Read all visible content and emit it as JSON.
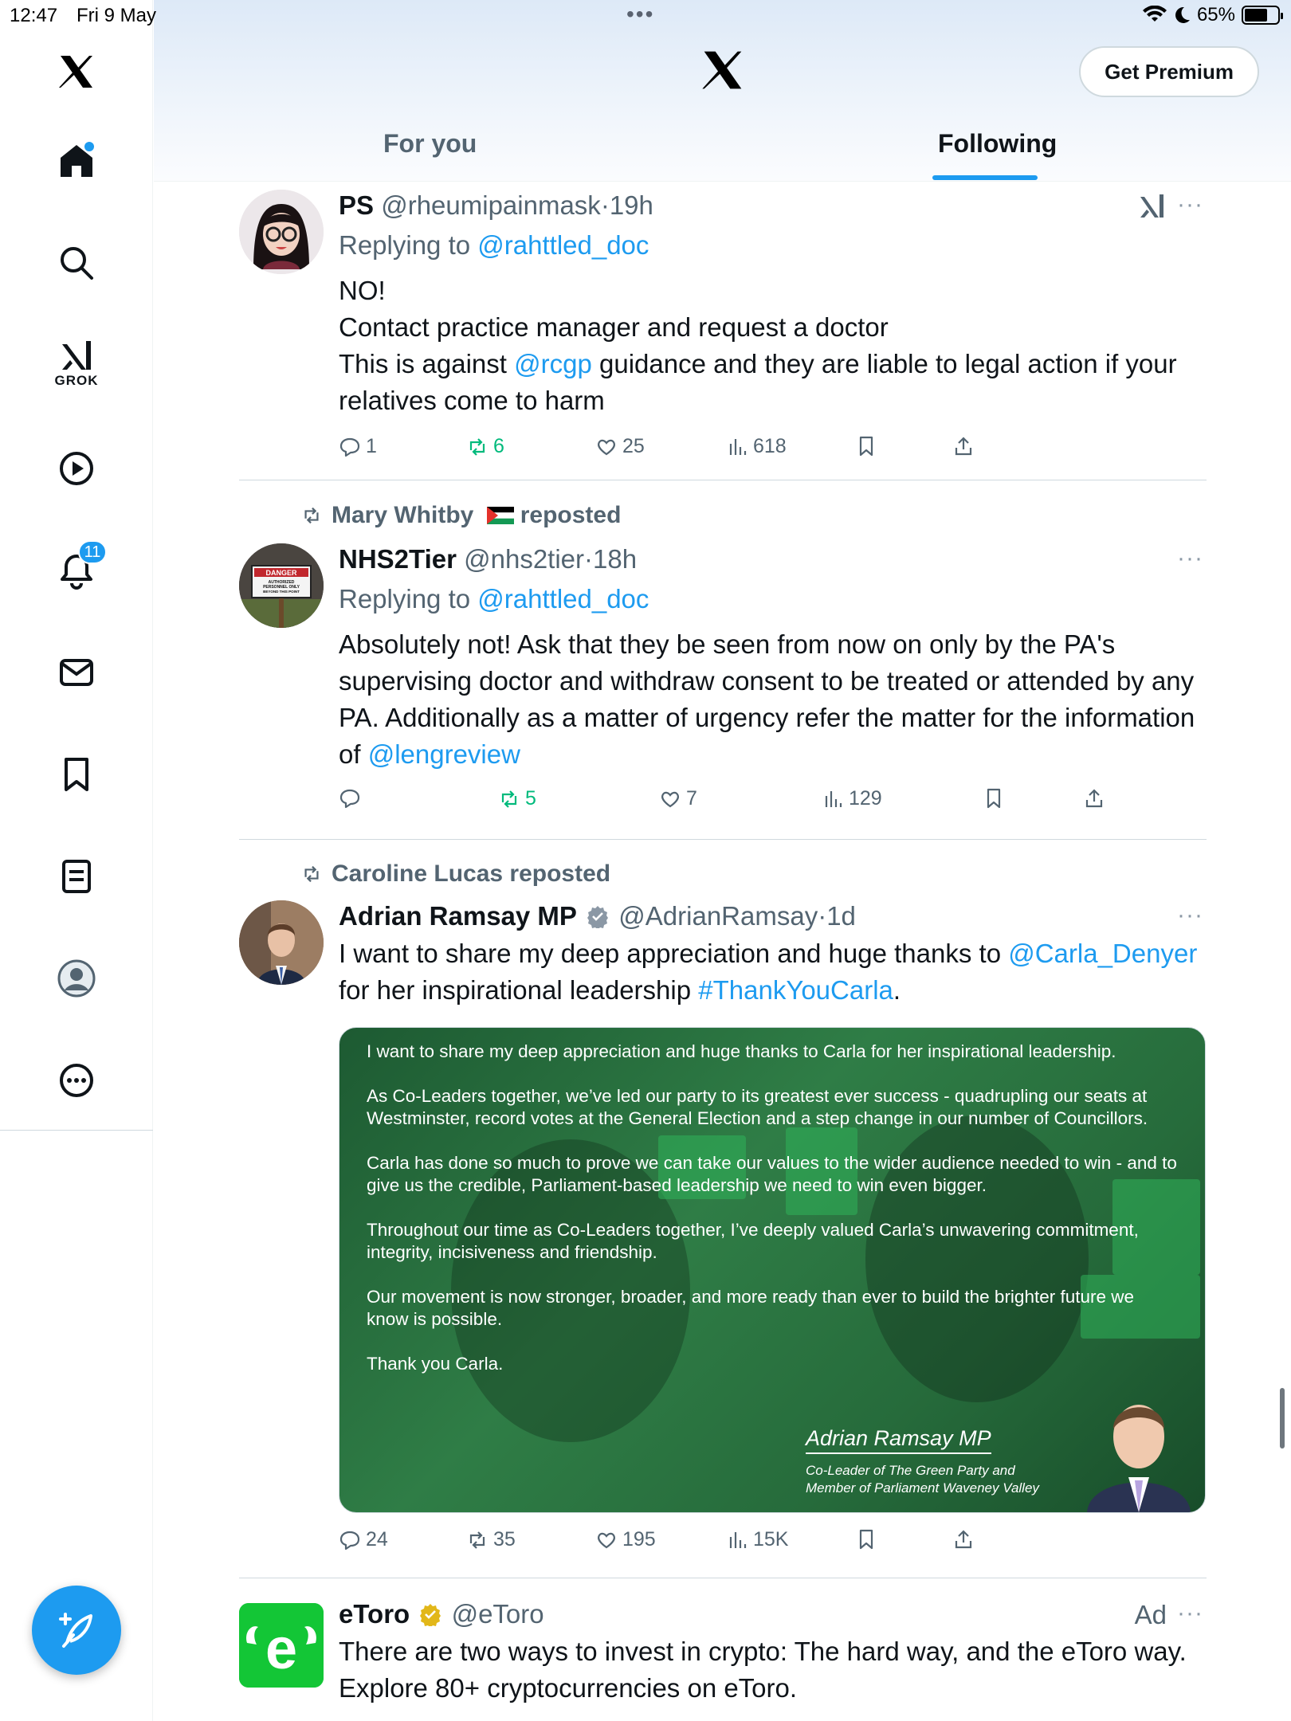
{
  "status_bar": {
    "time": "12:47",
    "date": "Fri 9 May",
    "battery": "65%",
    "battery_level": 0.65
  },
  "sidebar": {
    "items": [
      {
        "icon": "x-logo-icon"
      },
      {
        "icon": "home-icon"
      },
      {
        "icon": "search-icon"
      },
      {
        "icon": "grok-icon",
        "label": "GROK"
      },
      {
        "icon": "video-icon"
      },
      {
        "icon": "notifications-icon",
        "badge": "11"
      },
      {
        "icon": "messages-icon"
      },
      {
        "icon": "bookmarks-icon"
      },
      {
        "icon": "lists-icon"
      },
      {
        "icon": "profile-icon"
      },
      {
        "icon": "more-icon"
      }
    ],
    "compose_icon": "compose-feather-icon"
  },
  "header": {
    "premium_label": "Get Premium",
    "tabs": [
      "For you",
      "Following"
    ],
    "active_tab": "Following"
  },
  "posts": [
    {
      "name": "PS",
      "handle": "@rheumipainmask",
      "sep": "·",
      "time": "19h",
      "replying_prefix": "Replying to",
      "replying_to": "@rahttled_doc",
      "lines": [
        "NO!",
        "Contact practice manager and request a doctor"
      ],
      "line3_a": "This is against",
      "line3_link": "@rcgp",
      "line3_b": "guidance and they are liable to legal action if your relatives come to harm",
      "replies": "1",
      "reposts": "6",
      "likes": "25",
      "views": "618"
    },
    {
      "reposted_by": "Mary Whitby",
      "reposted_suffix": "reposted",
      "name": "NHS2Tier",
      "handle": "@nhs2tier",
      "sep": "·",
      "time": "18h",
      "replying_prefix": "Replying to",
      "replying_to": "@rahttled_doc",
      "text": "Absolutely not! Ask that they be seen from now on only by the PA's supervising doctor and withdraw consent to be treated or attended by any PA. Additionally as a matter of urgency refer the matter for the information of",
      "text_link": "@lengreview",
      "avatar_sign": [
        "DANGER",
        "AUTHORIZED",
        "PERSONNEL ONLY",
        "BEYOND THIS POINT"
      ],
      "replies": "",
      "reposts": "5",
      "likes": "7",
      "views": "129"
    },
    {
      "reposted_by": "Caroline Lucas reposted",
      "name": "Adrian Ramsay MP",
      "handle": "@AdrianRamsay",
      "sep": "·",
      "time": "1d",
      "text_a": "I want to share my deep appreciation and huge thanks to",
      "text_link1": "@Carla_Denyer",
      "text_b": "for her inspirational leadership",
      "text_link2": "#ThankYouCarla",
      "text_c": ".",
      "media": {
        "paragraphs": [
          "I want to share my deep appreciation and huge thanks to Carla for her inspirational leadership.",
          "As Co-Leaders together, we’ve led our party to its greatest ever success - quadrupling our seats at Westminster, record votes at the General Election and a step change in our number of Councillors.",
          "Carla has done so much to prove we can take our values to the wider audience needed to win - and to give us the credible, Parliament-based leadership we need to win even bigger.",
          "Throughout our time as Co-Leaders together, I’ve deeply valued Carla’s unwavering commitment, integrity, incisiveness and friendship.",
          "Our movement is now stronger, broader, and more ready than ever to build the brighter future we know is possible.",
          "Thank you Carla."
        ],
        "signature_name": "Adrian Ramsay MP",
        "signature_role1": "Co-Leader of The Green Party and",
        "signature_role2": "Member of Parliament Waveney Valley"
      },
      "replies": "24",
      "reposts": "35",
      "likes": "195",
      "views": "15K"
    },
    {
      "name": "eToro",
      "handle": "@eToro",
      "ad_label": "Ad",
      "text": "There are two ways to invest in crypto: The hard way, and the eToro way. Explore 80+ cryptocurrencies on eToro."
    }
  ],
  "colors": {
    "accent": "#1d9bf0",
    "muted": "#536471",
    "repost_green": "#00ba7c",
    "etoro_green": "#13c636"
  }
}
